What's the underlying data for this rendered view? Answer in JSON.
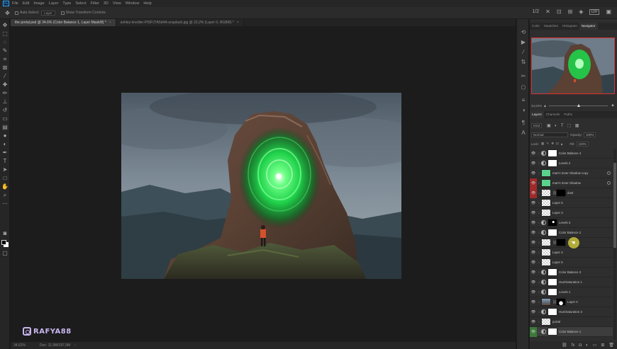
{
  "menu": [
    "File",
    "Edit",
    "Image",
    "Layer",
    "Type",
    "Select",
    "Filter",
    "3D",
    "View",
    "Window",
    "Help"
  ],
  "options": {
    "auto_select_label": "Auto-Select:",
    "auto_select_value": "Layer",
    "show_transform_label": "Show Transform Controls"
  },
  "top_right": {
    "zoom_ratio": "1/2",
    "gif_label": "GIF"
  },
  "tabs": [
    {
      "label": "the portal.psd @ 34,6% (Color Balance 1, Layer Mask/8) *",
      "active": true
    },
    {
      "label": "ashley-knedler-PfSPJ7A5d4A-unsplash.jpg @ 22,2% (Layer 0, RGB/8) *",
      "active": false
    }
  ],
  "status": {
    "zoom": "34,62%",
    "doc": "Doc: 11,9M/187,9M"
  },
  "watermark": "RAFYA88",
  "panels": {
    "top_tabs": [
      "Color",
      "Swatches",
      "Histogram",
      "Navigator"
    ],
    "active_top_tab": "Navigator",
    "navigator_zoom": "34,62%",
    "layer_tabs": [
      "Layers",
      "Channels",
      "Paths"
    ],
    "active_layer_tab": "Layers",
    "kind_label": "Kind",
    "blend_mode": "Normal",
    "opacity_label": "Opacity:",
    "opacity_value": "100%",
    "lock_label": "Lock:",
    "fill_label": "Fill:",
    "fill_value": "100%"
  },
  "layers": [
    {
      "name": "Color Balance 4",
      "eye": "normal",
      "thumb": "white",
      "adj": true
    },
    {
      "name": "Levels 2",
      "eye": "normal",
      "thumb": "white",
      "adj": true
    },
    {
      "name": "man's Inner Shadow copy",
      "eye": "normal",
      "thumb": "green",
      "adj": false,
      "fx": true
    },
    {
      "name": "man's Inner Shadow",
      "eye": "red",
      "thumb": "green",
      "adj": false,
      "fx": true
    },
    {
      "name": "dust",
      "eye": "red",
      "thumb": "checker",
      "mask": "black",
      "adj": false
    },
    {
      "name": "Layer 6",
      "eye": "normal",
      "thumb": "checker",
      "adj": false
    },
    {
      "name": "Layer 3",
      "eye": "normal",
      "thumb": "checker",
      "adj": false
    },
    {
      "name": "Levels 3",
      "eye": "normal",
      "thumb": "mask-dot",
      "adj": true
    },
    {
      "name": "Color Balance 2",
      "eye": "normal",
      "thumb": "white",
      "adj": true
    },
    {
      "name": "",
      "eye": "normal",
      "thumb": "checker",
      "mask": "black",
      "adj": false
    },
    {
      "name": "Layer 4",
      "eye": "normal",
      "thumb": "checker",
      "adj": false
    },
    {
      "name": "Layer 5",
      "eye": "normal",
      "thumb": "checker",
      "adj": false
    },
    {
      "name": "Color Balance 3",
      "eye": "normal",
      "thumb": "white",
      "adj": true
    },
    {
      "name": "Hue/Saturation 1",
      "eye": "normal",
      "thumb": "white",
      "adj": true
    },
    {
      "name": "Levels 1",
      "eye": "normal",
      "thumb": "white",
      "adj": true
    },
    {
      "name": "Layer 0",
      "eye": "normal",
      "thumb": "photo",
      "mask": "mask-shape",
      "adj": false
    },
    {
      "name": "Hue/Saturation 2",
      "eye": "normal",
      "thumb": "white",
      "adj": true
    },
    {
      "name": "portal",
      "eye": "normal",
      "thumb": "checker",
      "adj": false
    },
    {
      "name": "Color Balance 1",
      "eye": "green",
      "thumb": "white",
      "adj": true,
      "selected": true
    }
  ]
}
